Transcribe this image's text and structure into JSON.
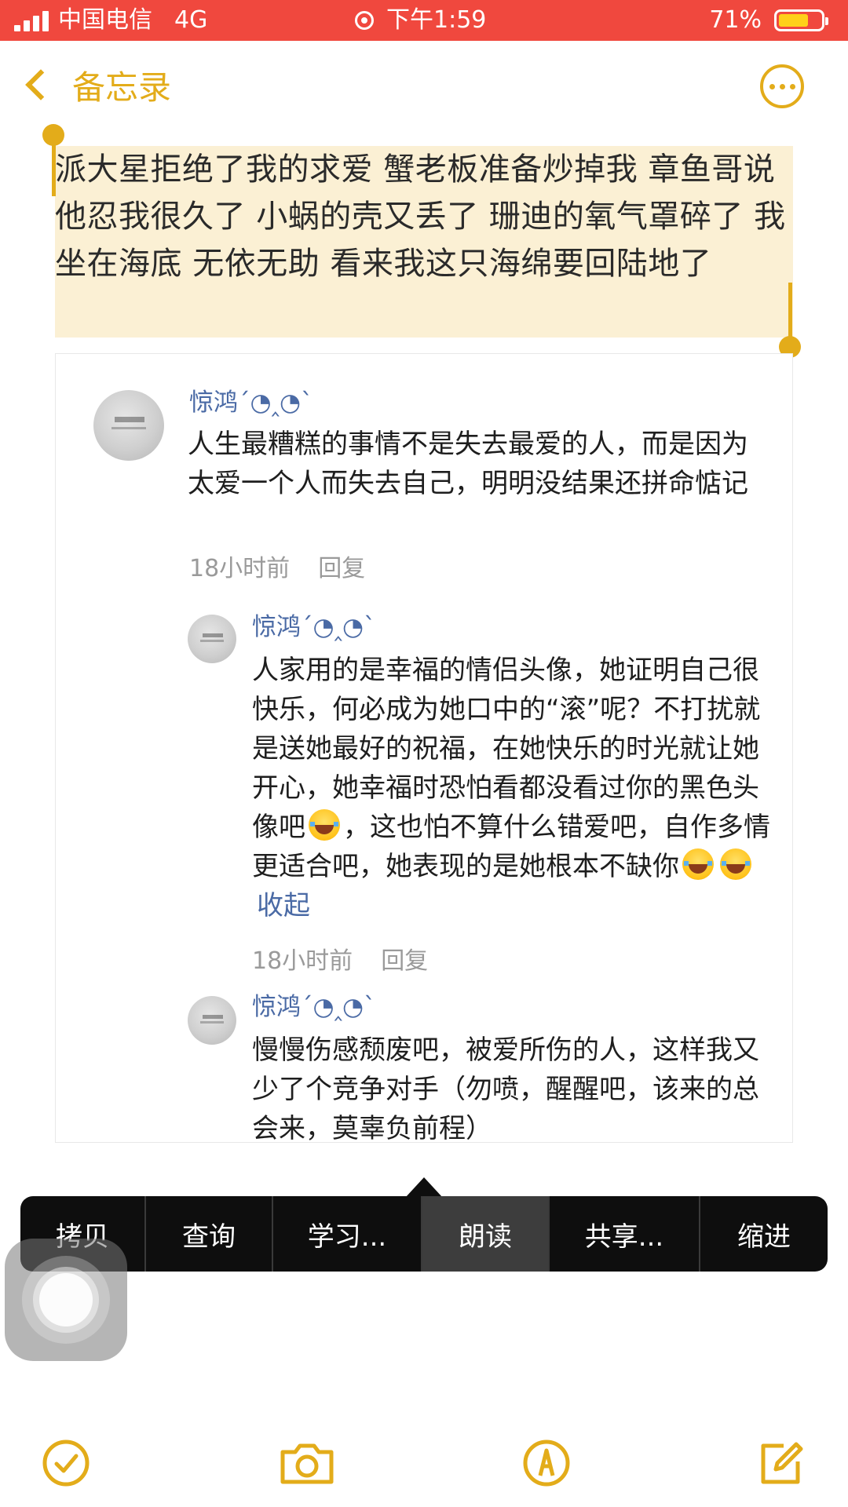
{
  "status_bar": {
    "carrier": "中国电信",
    "network": "4G",
    "time": "下午1:59",
    "battery_pct": "71%",
    "battery_level": 0.71,
    "bg_color": "#f0483e"
  },
  "nav": {
    "back_label": "备忘录",
    "accent_color": "#e3ac1a"
  },
  "note": {
    "selected_text": "派大星拒绝了我的求爱 蟹老板准备炒掉我 章鱼哥说他忍我很久了 小蜗的壳又丢了 珊迪的氧气罩碎了 我坐在海底 无依无助 看来我这只海绵要回陆地了"
  },
  "comments": [
    {
      "name": "惊鸿´◔‸◔`",
      "text": "人生最糟糕的事情不是失去最爱的人，而是因为太爱一个人而失去自己，明明没结果还拼命惦记",
      "time": "18小时前",
      "reply": "回复"
    },
    {
      "name": "惊鸿´◔‸◔`",
      "text_part1": "人家用的是幸福的情侣头像，她证明自己很快乐，何必成为她口中的“滚”呢？不打扰就是送她最好的祝福，在她快乐的时光就让她开心，她幸福时恐怕看都没看过你的黑色头像吧",
      "text_part2": "，这也怕不算什么错爱吧，自作多情更适合吧，她表现的是她根本不缺你",
      "emoji": "tears-of-joy-emoji",
      "collapse": "收起",
      "time": "18小时前",
      "reply": "回复"
    },
    {
      "name": "惊鸿´◔‸◔`",
      "text": "慢慢伤感颓废吧，被爱所伤的人，这样我又少了个竞争对手（勿喷，醒醒吧，该来的总会来，莫辜负前程）"
    }
  ],
  "edit_menu": {
    "items": [
      "拷贝",
      "查询",
      "学习...",
      "朗读",
      "共享...",
      "缩进"
    ],
    "active": "朗读"
  },
  "toolbar": {
    "icons": [
      "checklist-icon",
      "camera-icon",
      "markup-icon",
      "compose-icon"
    ]
  }
}
